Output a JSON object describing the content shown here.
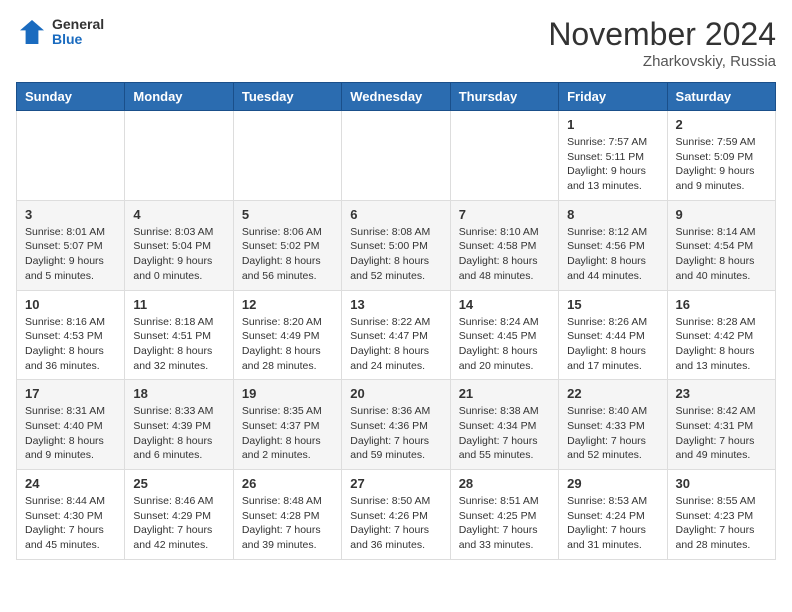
{
  "header": {
    "logo_general": "General",
    "logo_blue": "Blue",
    "month_title": "November 2024",
    "location": "Zharkovskiy, Russia"
  },
  "weekdays": [
    "Sunday",
    "Monday",
    "Tuesday",
    "Wednesday",
    "Thursday",
    "Friday",
    "Saturday"
  ],
  "weeks": [
    [
      {
        "day": "",
        "info": ""
      },
      {
        "day": "",
        "info": ""
      },
      {
        "day": "",
        "info": ""
      },
      {
        "day": "",
        "info": ""
      },
      {
        "day": "",
        "info": ""
      },
      {
        "day": "1",
        "info": "Sunrise: 7:57 AM\nSunset: 5:11 PM\nDaylight: 9 hours and 13 minutes."
      },
      {
        "day": "2",
        "info": "Sunrise: 7:59 AM\nSunset: 5:09 PM\nDaylight: 9 hours and 9 minutes."
      }
    ],
    [
      {
        "day": "3",
        "info": "Sunrise: 8:01 AM\nSunset: 5:07 PM\nDaylight: 9 hours and 5 minutes."
      },
      {
        "day": "4",
        "info": "Sunrise: 8:03 AM\nSunset: 5:04 PM\nDaylight: 9 hours and 0 minutes."
      },
      {
        "day": "5",
        "info": "Sunrise: 8:06 AM\nSunset: 5:02 PM\nDaylight: 8 hours and 56 minutes."
      },
      {
        "day": "6",
        "info": "Sunrise: 8:08 AM\nSunset: 5:00 PM\nDaylight: 8 hours and 52 minutes."
      },
      {
        "day": "7",
        "info": "Sunrise: 8:10 AM\nSunset: 4:58 PM\nDaylight: 8 hours and 48 minutes."
      },
      {
        "day": "8",
        "info": "Sunrise: 8:12 AM\nSunset: 4:56 PM\nDaylight: 8 hours and 44 minutes."
      },
      {
        "day": "9",
        "info": "Sunrise: 8:14 AM\nSunset: 4:54 PM\nDaylight: 8 hours and 40 minutes."
      }
    ],
    [
      {
        "day": "10",
        "info": "Sunrise: 8:16 AM\nSunset: 4:53 PM\nDaylight: 8 hours and 36 minutes."
      },
      {
        "day": "11",
        "info": "Sunrise: 8:18 AM\nSunset: 4:51 PM\nDaylight: 8 hours and 32 minutes."
      },
      {
        "day": "12",
        "info": "Sunrise: 8:20 AM\nSunset: 4:49 PM\nDaylight: 8 hours and 28 minutes."
      },
      {
        "day": "13",
        "info": "Sunrise: 8:22 AM\nSunset: 4:47 PM\nDaylight: 8 hours and 24 minutes."
      },
      {
        "day": "14",
        "info": "Sunrise: 8:24 AM\nSunset: 4:45 PM\nDaylight: 8 hours and 20 minutes."
      },
      {
        "day": "15",
        "info": "Sunrise: 8:26 AM\nSunset: 4:44 PM\nDaylight: 8 hours and 17 minutes."
      },
      {
        "day": "16",
        "info": "Sunrise: 8:28 AM\nSunset: 4:42 PM\nDaylight: 8 hours and 13 minutes."
      }
    ],
    [
      {
        "day": "17",
        "info": "Sunrise: 8:31 AM\nSunset: 4:40 PM\nDaylight: 8 hours and 9 minutes."
      },
      {
        "day": "18",
        "info": "Sunrise: 8:33 AM\nSunset: 4:39 PM\nDaylight: 8 hours and 6 minutes."
      },
      {
        "day": "19",
        "info": "Sunrise: 8:35 AM\nSunset: 4:37 PM\nDaylight: 8 hours and 2 minutes."
      },
      {
        "day": "20",
        "info": "Sunrise: 8:36 AM\nSunset: 4:36 PM\nDaylight: 7 hours and 59 minutes."
      },
      {
        "day": "21",
        "info": "Sunrise: 8:38 AM\nSunset: 4:34 PM\nDaylight: 7 hours and 55 minutes."
      },
      {
        "day": "22",
        "info": "Sunrise: 8:40 AM\nSunset: 4:33 PM\nDaylight: 7 hours and 52 minutes."
      },
      {
        "day": "23",
        "info": "Sunrise: 8:42 AM\nSunset: 4:31 PM\nDaylight: 7 hours and 49 minutes."
      }
    ],
    [
      {
        "day": "24",
        "info": "Sunrise: 8:44 AM\nSunset: 4:30 PM\nDaylight: 7 hours and 45 minutes."
      },
      {
        "day": "25",
        "info": "Sunrise: 8:46 AM\nSunset: 4:29 PM\nDaylight: 7 hours and 42 minutes."
      },
      {
        "day": "26",
        "info": "Sunrise: 8:48 AM\nSunset: 4:28 PM\nDaylight: 7 hours and 39 minutes."
      },
      {
        "day": "27",
        "info": "Sunrise: 8:50 AM\nSunset: 4:26 PM\nDaylight: 7 hours and 36 minutes."
      },
      {
        "day": "28",
        "info": "Sunrise: 8:51 AM\nSunset: 4:25 PM\nDaylight: 7 hours and 33 minutes."
      },
      {
        "day": "29",
        "info": "Sunrise: 8:53 AM\nSunset: 4:24 PM\nDaylight: 7 hours and 31 minutes."
      },
      {
        "day": "30",
        "info": "Sunrise: 8:55 AM\nSunset: 4:23 PM\nDaylight: 7 hours and 28 minutes."
      }
    ]
  ]
}
